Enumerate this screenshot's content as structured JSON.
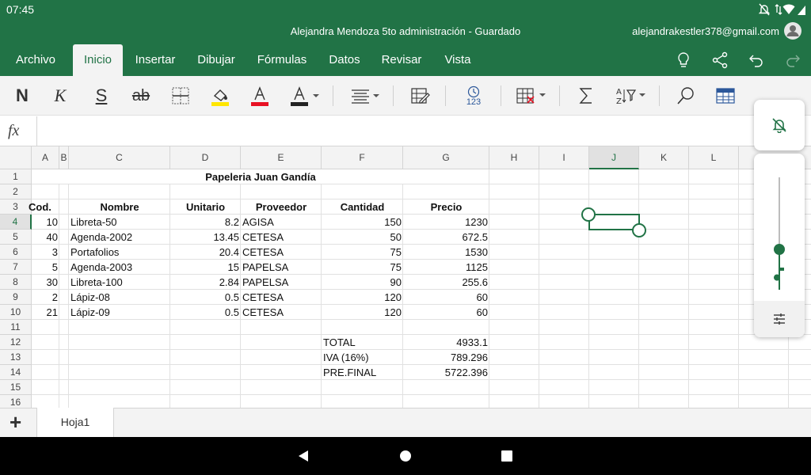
{
  "status": {
    "time": "07:45"
  },
  "title": {
    "document": "Alejandra Mendoza 5to administración - Guardado",
    "account": "alejandrakestler378@gmail.com"
  },
  "tabs": [
    {
      "label": "Archivo"
    },
    {
      "label": "Inicio"
    },
    {
      "label": "Insertar"
    },
    {
      "label": "Dibujar"
    },
    {
      "label": "Fórmulas"
    },
    {
      "label": "Datos"
    },
    {
      "label": "Revisar"
    },
    {
      "label": "Vista"
    }
  ],
  "toolbar": {
    "bold": "N",
    "italic": "K",
    "underline": "S",
    "strike": "ab",
    "number_format_hint": "123"
  },
  "formula": {
    "fx": "fx",
    "value": ""
  },
  "columns": [
    "A",
    "B",
    "C",
    "D",
    "E",
    "F",
    "G",
    "H",
    "I",
    "J",
    "K",
    "L"
  ],
  "rows": [
    "1",
    "2",
    "3",
    "4",
    "5",
    "6",
    "7",
    "8",
    "9",
    "10",
    "11",
    "12",
    "13",
    "14",
    "15",
    "16"
  ],
  "sheet": {
    "title": "Papeleria Juan Gandía",
    "headers": {
      "cod": "Cod.",
      "nombre": "Nombre",
      "unitario": "Unitario",
      "proveedor": "Proveedor",
      "cantidad": "Cantidad",
      "precio": "Precio"
    },
    "items": [
      {
        "cod": "10",
        "nombre": "Libreta-50",
        "unitario": "8.2",
        "proveedor": "AGISA",
        "cantidad": "150",
        "precio": "1230"
      },
      {
        "cod": "40",
        "nombre": "Agenda-2002",
        "unitario": "13.45",
        "proveedor": "CETESA",
        "cantidad": "50",
        "precio": "672.5"
      },
      {
        "cod": "3",
        "nombre": "Portafolios",
        "unitario": "20.4",
        "proveedor": "CETESA",
        "cantidad": "75",
        "precio": "1530"
      },
      {
        "cod": "5",
        "nombre": "Agenda-2003",
        "unitario": "15",
        "proveedor": "PAPELSA",
        "cantidad": "75",
        "precio": "1125"
      },
      {
        "cod": "30",
        "nombre": "Libreta-100",
        "unitario": "2.84",
        "proveedor": "PAPELSA",
        "cantidad": "90",
        "precio": "255.6"
      },
      {
        "cod": "2",
        "nombre": "Lápiz-08",
        "unitario": "0.5",
        "proveedor": "CETESA",
        "cantidad": "120",
        "precio": "60"
      },
      {
        "cod": "21",
        "nombre": "Lápiz-09",
        "unitario": "0.5",
        "proveedor": "CETESA",
        "cantidad": "120",
        "precio": "60"
      }
    ],
    "totals": [
      {
        "label": "TOTAL",
        "value": "4933.1"
      },
      {
        "label": "IVA (16%)",
        "value": "789.296"
      },
      {
        "label": "PRE.FINAL",
        "value": "5722.396"
      }
    ]
  },
  "sheet_tabs": {
    "add": "+",
    "active": "Hoja1"
  },
  "colors": {
    "excel_green": "#217346",
    "ribbon_bg": "#f3f3f3",
    "selection": "#217346",
    "highlight_yellow": "#ffe600",
    "font_red": "#e81123"
  },
  "volume": {
    "level": 0.36
  }
}
